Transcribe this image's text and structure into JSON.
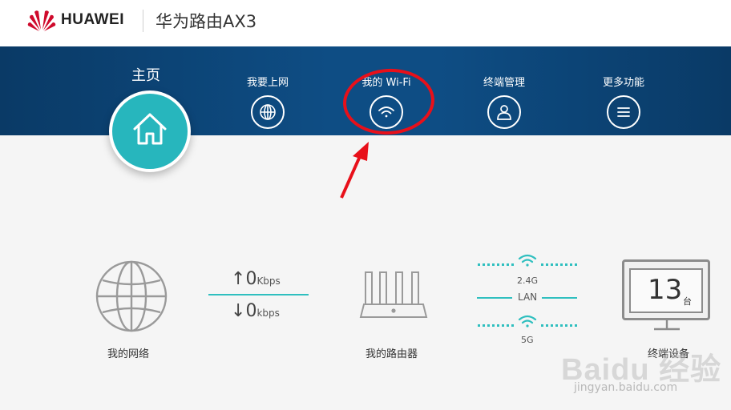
{
  "header": {
    "brand": "HUAWEI",
    "product": "华为路由AX3"
  },
  "nav": {
    "home_label": "主页",
    "items": [
      {
        "label": "我要上网",
        "icon": "globe-icon"
      },
      {
        "label": "我的 Wi-Fi",
        "icon": "wifi-icon"
      },
      {
        "label": "终端管理",
        "icon": "user-icon"
      },
      {
        "label": "更多功能",
        "icon": "menu-icon"
      }
    ]
  },
  "status": {
    "network_label": "我的网络",
    "upload_value": "0",
    "upload_unit": "Kbps",
    "download_value": "0",
    "download_unit": "kbps",
    "router_label": "我的路由器",
    "band_24": "2.4G",
    "lan": "LAN",
    "band_5": "5G",
    "device_count": "13",
    "device_unit": "台",
    "devices_label": "终端设备"
  },
  "watermark": {
    "text": "Baidu 经验",
    "sub": "jingyan.baidu.com"
  },
  "colors": {
    "nav_bg": "#0e4d84",
    "accent": "#27b6bd",
    "annotation": "#e8101a",
    "brand_red": "#cf0a2c"
  }
}
